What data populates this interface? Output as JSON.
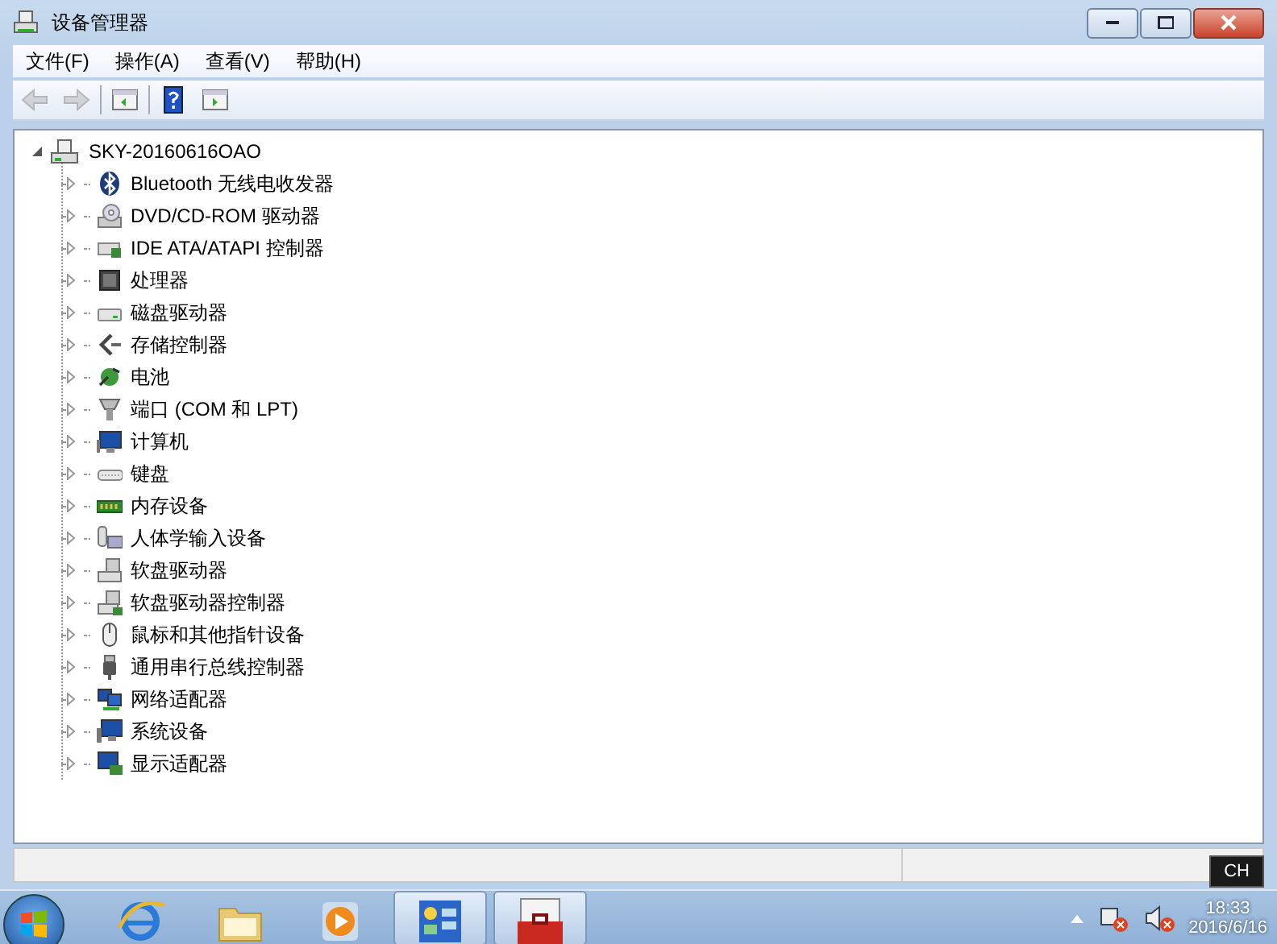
{
  "window": {
    "title": "设备管理器"
  },
  "menu": [
    {
      "label": "文件(F)"
    },
    {
      "label": "操作(A)"
    },
    {
      "label": "查看(V)"
    },
    {
      "label": "帮助(H)"
    }
  ],
  "toolbar": [
    {
      "kind": "back",
      "disabled": true
    },
    {
      "kind": "forward",
      "disabled": true
    },
    {
      "kind": "tree",
      "disabled": false
    },
    {
      "kind": "help",
      "disabled": false
    },
    {
      "kind": "pane",
      "disabled": false
    }
  ],
  "tree": {
    "label": "SKY-20160616OAO",
    "expanded": true,
    "children": [
      {
        "label": "Bluetooth 无线电收发器",
        "kind": "bluetooth",
        "expanded": false
      },
      {
        "label": "DVD/CD-ROM 驱动器",
        "kind": "disc",
        "expanded": false
      },
      {
        "label": "IDE ATA/ATAPI 控制器",
        "kind": "controller",
        "expanded": false
      },
      {
        "label": "处理器",
        "kind": "chip",
        "expanded": false
      },
      {
        "label": "磁盘驱动器",
        "kind": "disk",
        "expanded": false
      },
      {
        "label": "存储控制器",
        "kind": "storage",
        "expanded": false
      },
      {
        "label": "电池",
        "kind": "battery",
        "expanded": false
      },
      {
        "label": "端口 (COM 和 LPT)",
        "kind": "port",
        "expanded": false
      },
      {
        "label": "计算机",
        "kind": "computer",
        "expanded": false
      },
      {
        "label": "键盘",
        "kind": "keyboard",
        "expanded": false
      },
      {
        "label": "内存设备",
        "kind": "memory",
        "expanded": false
      },
      {
        "label": "人体学输入设备",
        "kind": "hid",
        "expanded": false
      },
      {
        "label": "软盘驱动器",
        "kind": "floppy",
        "expanded": false
      },
      {
        "label": "软盘驱动器控制器",
        "kind": "floppyctrl",
        "expanded": false
      },
      {
        "label": "鼠标和其他指针设备",
        "kind": "mouse",
        "expanded": false
      },
      {
        "label": "通用串行总线控制器",
        "kind": "usb",
        "expanded": false
      },
      {
        "label": "网络适配器",
        "kind": "network",
        "expanded": false
      },
      {
        "label": "系统设备",
        "kind": "system",
        "expanded": false
      },
      {
        "label": "显示适配器",
        "kind": "display",
        "expanded": false
      }
    ]
  },
  "taskbar": {
    "items": [
      {
        "kind": "browser",
        "open": false
      },
      {
        "kind": "folder",
        "open": false
      },
      {
        "kind": "media",
        "open": false
      },
      {
        "kind": "control",
        "open": true
      },
      {
        "kind": "toolbox",
        "open": true
      }
    ],
    "tray": {
      "language": "CH",
      "time": "18:33",
      "date": "2016/6/16"
    }
  }
}
